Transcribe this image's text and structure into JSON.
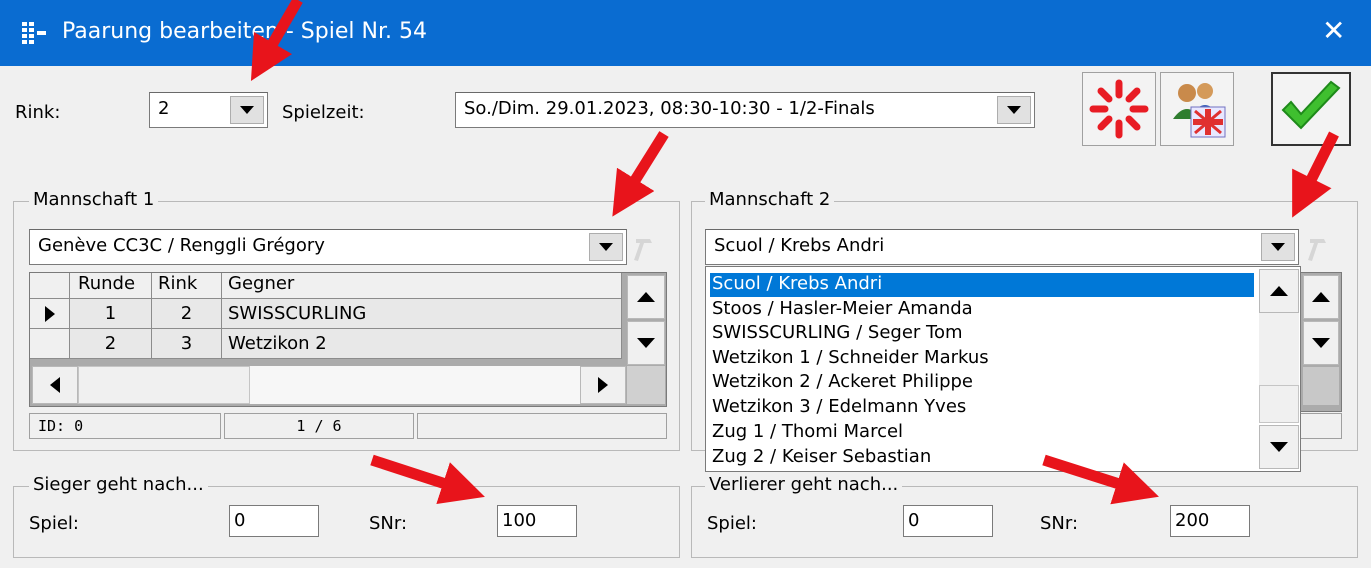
{
  "window": {
    "title": "Paarung bearbeiten - Spiel Nr. 54",
    "close_icon": "close-icon"
  },
  "top": {
    "rink_label": "Rink:",
    "rink_value": "2",
    "spielzeit_label": "Spielzeit:",
    "spielzeit_value": "So./Dim. 29.01.2023, 08:30-10:30 - 1/2-Finals"
  },
  "toolbar": {
    "reset_icon": "spinner-icon",
    "teams_icon": "teams-flag-icon",
    "ok_icon": "checkmark-icon"
  },
  "team1": {
    "legend": "Mannschaft 1",
    "value": "Genève CC3C / Renggli Grégory",
    "grid": {
      "columns": [
        "Runde",
        "Rink",
        "Gegner"
      ],
      "rows": [
        {
          "runde": "1",
          "rink": "2",
          "gegner": "SWISSCURLING"
        },
        {
          "runde": "2",
          "rink": "3",
          "gegner": "Wetzikon 2"
        }
      ]
    },
    "status": {
      "id": "ID: 0",
      "pos": "1 / 6"
    }
  },
  "team2": {
    "legend": "Mannschaft 2",
    "value": "Scuol / Krebs Andri",
    "dropdown_items": [
      "Scuol / Krebs Andri",
      "Stoos / Hasler-Meier Amanda",
      "SWISSCURLING / Seger Tom",
      "Wetzikon 1 / Schneider Markus",
      "Wetzikon 2 / Ackeret Philippe",
      "Wetzikon 3 / Edelmann Yves",
      "Zug 1 / Thomi Marcel",
      "Zug 2 / Keiser Sebastian"
    ]
  },
  "winner": {
    "legend": "Sieger geht nach...",
    "spiel_label": "Spiel:",
    "spiel_value": "0",
    "snr_label": "SNr:",
    "snr_value": "100"
  },
  "loser": {
    "legend": "Verlierer geht nach...",
    "spiel_label": "Spiel:",
    "spiel_value": "0",
    "snr_label": "SNr:",
    "snr_value": "200"
  },
  "colors": {
    "titlebar": "#0a6cd1",
    "selection": "#0078d7",
    "arrow": "#e8141b"
  }
}
